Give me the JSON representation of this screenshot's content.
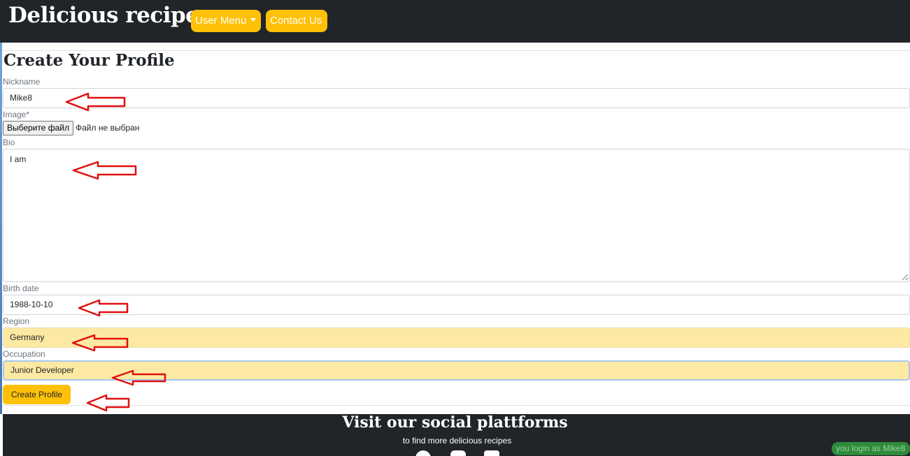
{
  "navbar": {
    "brand": "Delicious recipes",
    "user_menu": "User Menu",
    "contact": "Contact Us"
  },
  "form": {
    "title": "Create Your Profile",
    "nickname": {
      "label": "Nickname",
      "value": "Mike8"
    },
    "image": {
      "label": "Image*",
      "button": "Выберите файл",
      "status": "Файл не выбран"
    },
    "bio": {
      "label": "Bio",
      "value": "I am"
    },
    "birth_date": {
      "label": "Birth date",
      "value": "1988-10-10"
    },
    "region": {
      "label": "Region",
      "value": "Germany"
    },
    "occupation": {
      "label": "Occupation",
      "value": "Junior Developer"
    },
    "submit": "Create Profile"
  },
  "footer": {
    "title": "Visit our social plattforms",
    "subtitle": "to find more delicious recipes",
    "icons": [
      "facebook-icon",
      "instagram-icon",
      "youtube-icon"
    ]
  },
  "login_badge": "you login as Mike8",
  "colors": {
    "navbar": "#212529",
    "accent": "#ffc107",
    "autofill": "#fde9a1",
    "annotation_arrow": "#e01010",
    "badge": "#2e8b3a"
  }
}
